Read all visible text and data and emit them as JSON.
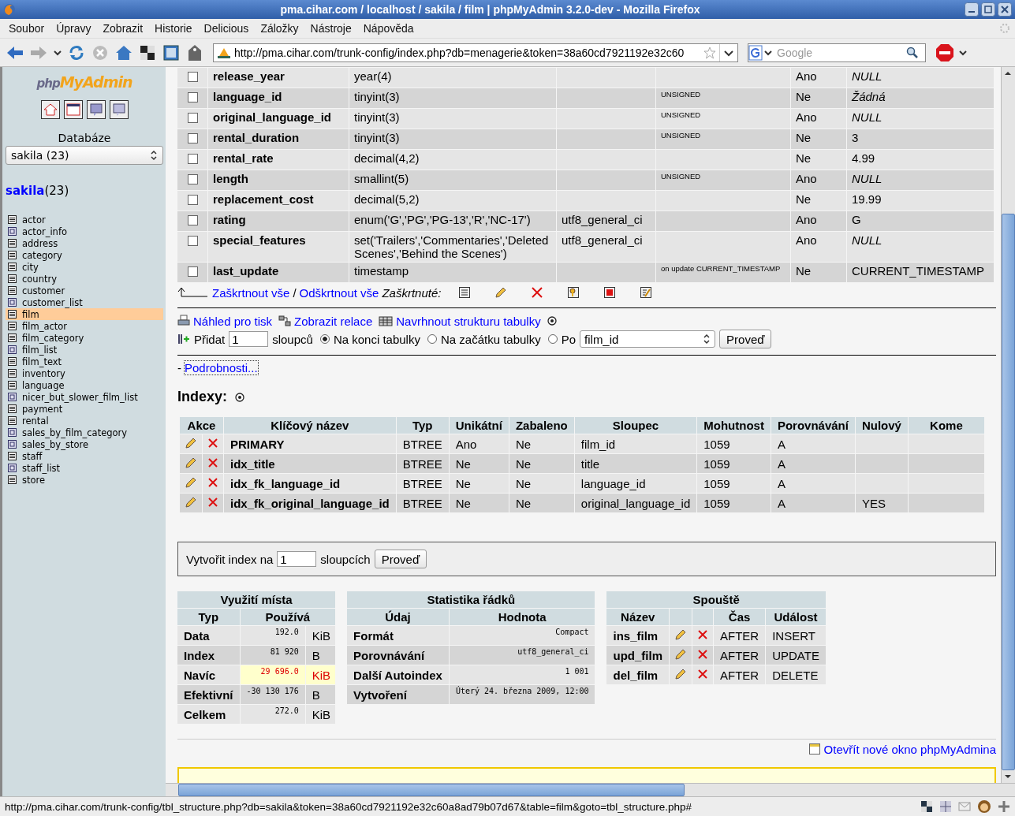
{
  "window": {
    "title": "pma.cihar.com / localhost / sakila / film | phpMyAdmin 3.2.0-dev - Mozilla Firefox"
  },
  "menu": [
    "Soubor",
    "Úpravy",
    "Zobrazit",
    "Historie",
    "Delicious",
    "Záložky",
    "Nástroje",
    "Nápověda"
  ],
  "address_bar": {
    "url": "http://pma.cihar.com/trunk-config/index.php?db=menagerie&token=38a60cd7921192e32c60"
  },
  "search": {
    "placeholder": "Google"
  },
  "sidebar": {
    "logo": {
      "prefix": "php",
      "name": "MyAdmin"
    },
    "database_label": "Databáze",
    "database_select": "sakila (23)",
    "db_name": "sakila",
    "db_count": "(23)",
    "tables": [
      {
        "name": "actor",
        "kind": "table",
        "selected": false
      },
      {
        "name": "actor_info",
        "kind": "view",
        "selected": false
      },
      {
        "name": "address",
        "kind": "table",
        "selected": false
      },
      {
        "name": "category",
        "kind": "table",
        "selected": false
      },
      {
        "name": "city",
        "kind": "table",
        "selected": false
      },
      {
        "name": "country",
        "kind": "table",
        "selected": false
      },
      {
        "name": "customer",
        "kind": "table",
        "selected": false
      },
      {
        "name": "customer_list",
        "kind": "view",
        "selected": false
      },
      {
        "name": "film",
        "kind": "table",
        "selected": true
      },
      {
        "name": "film_actor",
        "kind": "table",
        "selected": false
      },
      {
        "name": "film_category",
        "kind": "table",
        "selected": false
      },
      {
        "name": "film_list",
        "kind": "view",
        "selected": false
      },
      {
        "name": "film_text",
        "kind": "table",
        "selected": false
      },
      {
        "name": "inventory",
        "kind": "table",
        "selected": false
      },
      {
        "name": "language",
        "kind": "table",
        "selected": false
      },
      {
        "name": "nicer_but_slower_film_list",
        "kind": "view",
        "selected": false
      },
      {
        "name": "payment",
        "kind": "table",
        "selected": false
      },
      {
        "name": "rental",
        "kind": "table",
        "selected": false
      },
      {
        "name": "sales_by_film_category",
        "kind": "view",
        "selected": false
      },
      {
        "name": "sales_by_store",
        "kind": "view",
        "selected": false
      },
      {
        "name": "staff",
        "kind": "table",
        "selected": false
      },
      {
        "name": "staff_list",
        "kind": "view",
        "selected": false
      },
      {
        "name": "store",
        "kind": "table",
        "selected": false
      }
    ]
  },
  "structure": {
    "rows": [
      {
        "field": "release_year",
        "type": "year(4)",
        "collation": "",
        "attributes": "",
        "null": "Ano",
        "default": "NULL",
        "default_italic": true,
        "checked": false
      },
      {
        "field": "language_id",
        "type": "tinyint(3)",
        "collation": "",
        "attributes": "UNSIGNED",
        "null": "Ne",
        "default": "Žádná",
        "default_italic": true,
        "checked": false
      },
      {
        "field": "original_language_id",
        "type": "tinyint(3)",
        "collation": "",
        "attributes": "UNSIGNED",
        "null": "Ano",
        "default": "NULL",
        "default_italic": true,
        "checked": false
      },
      {
        "field": "rental_duration",
        "type": "tinyint(3)",
        "collation": "",
        "attributes": "UNSIGNED",
        "null": "Ne",
        "default": "3",
        "default_italic": false,
        "checked": false
      },
      {
        "field": "rental_rate",
        "type": "decimal(4,2)",
        "collation": "",
        "attributes": "",
        "null": "Ne",
        "default": "4.99",
        "default_italic": false,
        "checked": false
      },
      {
        "field": "length",
        "type": "smallint(5)",
        "collation": "",
        "attributes": "UNSIGNED",
        "null": "Ano",
        "default": "NULL",
        "default_italic": true,
        "checked": false
      },
      {
        "field": "replacement_cost",
        "type": "decimal(5,2)",
        "collation": "",
        "attributes": "",
        "null": "Ne",
        "default": "19.99",
        "default_italic": false,
        "checked": false
      },
      {
        "field": "rating",
        "type": "enum('G','PG','PG-13','R','NC-17')",
        "collation": "utf8_general_ci",
        "attributes": "",
        "null": "Ano",
        "default": "G",
        "default_italic": false,
        "checked": false
      },
      {
        "field": "special_features",
        "type": "set('Trailers','Commentaries','Deleted Scenes','Behind the Scenes')",
        "collation": "utf8_general_ci",
        "attributes": "",
        "null": "Ano",
        "default": "NULL",
        "default_italic": true,
        "checked": false
      },
      {
        "field": "last_update",
        "type": "timestamp",
        "collation": "",
        "attributes": "on update CURRENT_TIMESTAMP",
        "null": "Ne",
        "default": "CURRENT_TIMESTAMP",
        "default_italic": false,
        "checked": false
      }
    ],
    "check_all": "Zaškrtnout vše",
    "separator": "/",
    "uncheck_all": "Odškrtnout vše",
    "with_selected": "Zaškrtnuté:"
  },
  "links": {
    "print": "Náhled pro tisk",
    "relations": "Zobrazit relace",
    "propose": "Navrhnout strukturu tabulky"
  },
  "add_columns": {
    "label": "Přidat",
    "value": "1",
    "unit": "sloupců",
    "options": [
      {
        "label": "Na konci tabulky",
        "selected": true
      },
      {
        "label": "Na začátku tabulky",
        "selected": false
      },
      {
        "label": "Po",
        "selected": false
      }
    ],
    "after_field": "film_id",
    "button": "Proveď"
  },
  "details": {
    "dash": "-",
    "link": "Podrobnosti..."
  },
  "indexes": {
    "title": "Indexy:",
    "columns": [
      "Akce",
      "Klíčový název",
      "Typ",
      "Unikátní",
      "Zabaleno",
      "Sloupec",
      "Mohutnost",
      "Porovnávání",
      "Nulový",
      "Kome"
    ],
    "rows": [
      {
        "name": "PRIMARY",
        "type": "BTREE",
        "unique": "Ano",
        "packed": "Ne",
        "column": "film_id",
        "cardinality": "1059",
        "collation": "A",
        "null": ""
      },
      {
        "name": "idx_title",
        "type": "BTREE",
        "unique": "Ne",
        "packed": "Ne",
        "column": "title",
        "cardinality": "1059",
        "collation": "A",
        "null": ""
      },
      {
        "name": "idx_fk_language_id",
        "type": "BTREE",
        "unique": "Ne",
        "packed": "Ne",
        "column": "language_id",
        "cardinality": "1059",
        "collation": "A",
        "null": ""
      },
      {
        "name": "idx_fk_original_language_id",
        "type": "BTREE",
        "unique": "Ne",
        "packed": "Ne",
        "column": "original_language_id",
        "cardinality": "1059",
        "collation": "A",
        "null": "YES"
      }
    ]
  },
  "create_index": {
    "label": "Vytvořit index na",
    "value": "1",
    "unit": "sloupcích",
    "button": "Proveď"
  },
  "space_usage": {
    "title": "Využití místa",
    "columns": [
      "Typ",
      "Používá"
    ],
    "rows": [
      {
        "type": "Data",
        "value": "192.0",
        "unit": "KiB",
        "warning": false
      },
      {
        "type": "Index",
        "value": "81 920",
        "unit": "B",
        "warning": false
      },
      {
        "type": "Navíc",
        "value": "29 696.0",
        "unit": "KiB",
        "warning": true
      },
      {
        "type": "Efektivní",
        "value": "-30 130 176",
        "unit": "B",
        "warning": false
      },
      {
        "type": "Celkem",
        "value": "272.0",
        "unit": "KiB",
        "warning": false
      }
    ]
  },
  "row_stats": {
    "title": "Statistika řádků",
    "columns": [
      "Údaj",
      "Hodnota"
    ],
    "rows": [
      {
        "label": "Formát",
        "value": "Compact"
      },
      {
        "label": "Porovnávání",
        "value": "utf8_general_ci"
      },
      {
        "label": "Další Autoindex",
        "value": "1 001"
      },
      {
        "label": "Vytvoření",
        "value": "Úterý 24. března 2009, 12:00"
      }
    ]
  },
  "triggers": {
    "title": "Spouště",
    "columns": [
      "Název",
      "Čas",
      "Událost"
    ],
    "rows": [
      {
        "name": "ins_film",
        "time": "AFTER",
        "event": "INSERT"
      },
      {
        "name": "upd_film",
        "time": "AFTER",
        "event": "UPDATE"
      },
      {
        "name": "del_film",
        "time": "AFTER",
        "event": "DELETE"
      }
    ]
  },
  "new_window_link": "Otevřít nové okno phpMyAdmina",
  "status_bar": {
    "text": "http://pma.cihar.com/trunk-config/tbl_structure.php?db=sakila&token=38a60cd7921192e32c60a8ad79b07d67&table=film&goto=tbl_structure.php#"
  }
}
